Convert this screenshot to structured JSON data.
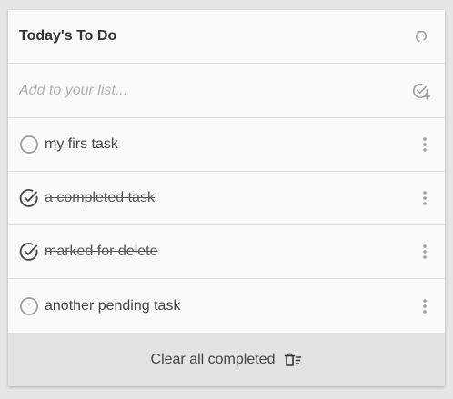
{
  "header": {
    "title": "Today's To Do",
    "refresh_icon": "refresh-icon"
  },
  "add": {
    "placeholder": "Add to your list...",
    "add_icon": "add-task-icon"
  },
  "tasks": [
    {
      "label": "my firs task",
      "completed": false
    },
    {
      "label": "a completed task",
      "completed": true
    },
    {
      "label": "marked for delete",
      "completed": true
    },
    {
      "label": "another pending task",
      "completed": false
    }
  ],
  "footer": {
    "label": "Clear all completed",
    "icon": "clear-list-icon"
  },
  "colors": {
    "background": "#e6e6e6",
    "card": "#fafafa",
    "footer": "#e3e3e3",
    "text": "#444444",
    "icon": "#9e9e9e"
  }
}
